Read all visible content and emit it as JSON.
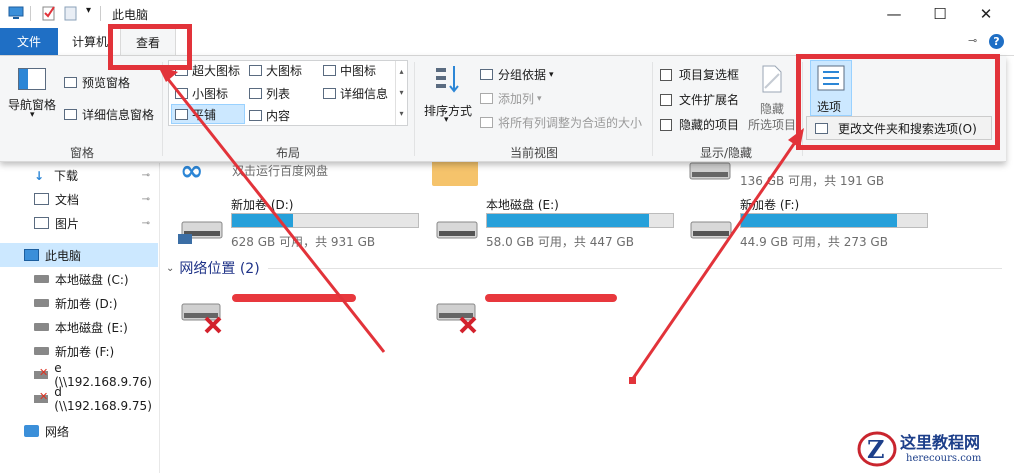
{
  "window": {
    "title": "此电脑",
    "minimize": "—",
    "maximize": "☐",
    "close": "✕"
  },
  "tabs": {
    "file": "文件",
    "computer": "计算机",
    "view": "查看"
  },
  "ribbon": {
    "panes": {
      "nav_pane": "导航窗格",
      "preview_pane": "预览窗格",
      "details_pane": "详细信息窗格",
      "group": "窗格"
    },
    "layout": {
      "items": [
        "超大图标",
        "大图标",
        "中图标",
        "小图标",
        "列表",
        "详细信息",
        "平铺",
        "内容"
      ],
      "selected": "平铺",
      "group": "布局"
    },
    "current_view": {
      "sort_by": "排序方式",
      "group_by": "分组依据",
      "add_column": "添加列",
      "fit_columns": "将所有列调整为合适的大小",
      "group": "当前视图"
    },
    "show_hide": {
      "item_checkboxes": "项目复选框",
      "file_extensions": "文件扩展名",
      "hidden_items": "隐藏的项目",
      "hide_selected_1": "隐藏",
      "hide_selected_2": "所选项目",
      "group": "显示/隐藏"
    },
    "options": {
      "label": "选项",
      "change_folder": "更改文件夹和搜索选项(O)"
    }
  },
  "nav": {
    "quick": [
      {
        "label": "下载"
      },
      {
        "label": "文档"
      },
      {
        "label": "图片"
      }
    ],
    "this_pc": "此电脑",
    "drives": [
      {
        "label": "本地磁盘 (C:)"
      },
      {
        "label": "新加卷 (D:)"
      },
      {
        "label": "本地磁盘 (E:)"
      },
      {
        "label": "新加卷 (F:)"
      },
      {
        "label": "e (\\\\192.168.9.76)"
      },
      {
        "label": "d (\\\\192.168.9.75)"
      }
    ],
    "network": "网络"
  },
  "content": {
    "partial_item_text": "双击运行百度网盘",
    "c_drive_free": "136 GB 可用，共 191 GB",
    "drives": [
      {
        "name": "新加卷 (D:)",
        "free": "628 GB 可用，共 931 GB",
        "used_fraction": 0.33
      },
      {
        "name": "本地磁盘 (E:)",
        "free": "58.0 GB 可用，共 447 GB",
        "used_fraction": 0.87
      },
      {
        "name": "新加卷 (F:)",
        "free": "44.9 GB 可用，共 273 GB",
        "used_fraction": 0.84
      }
    ],
    "network_header": "网络位置 (2)"
  },
  "watermark": {
    "name": "这里教程网",
    "url": "herecours.com"
  },
  "colors": {
    "accent": "#1f6fc5",
    "annotation_red": "#e2333a",
    "drive_bar": "#26a0da"
  }
}
